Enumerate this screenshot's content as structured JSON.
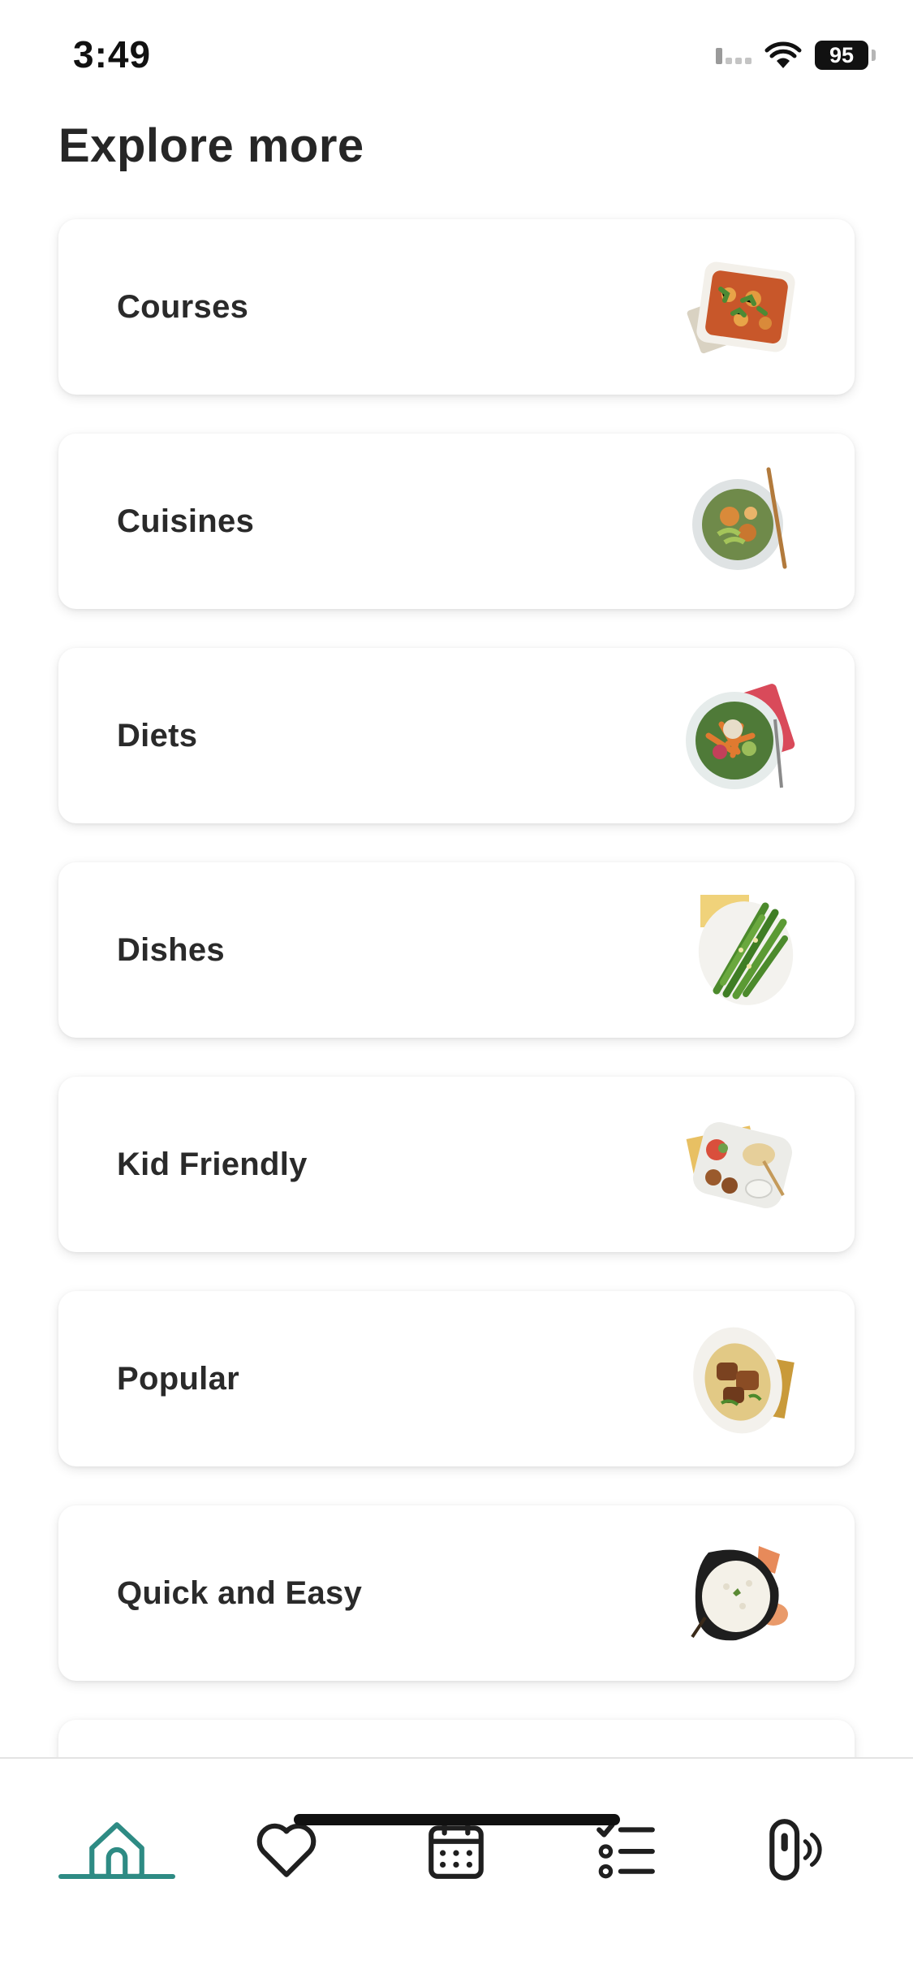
{
  "status_bar": {
    "time": "3:49",
    "battery": "95",
    "icons": [
      "cellular-signal-icon",
      "wifi-icon",
      "battery-icon"
    ]
  },
  "header": {
    "title": "Explore more"
  },
  "categories": [
    {
      "label": "Courses",
      "icon": "casserole-dish-icon"
    },
    {
      "label": "Cuisines",
      "icon": "noodle-bowl-icon"
    },
    {
      "label": "Diets",
      "icon": "salad-bowl-icon"
    },
    {
      "label": "Dishes",
      "icon": "asparagus-plate-icon"
    },
    {
      "label": "Kid Friendly",
      "icon": "kids-tray-icon"
    },
    {
      "label": "Popular",
      "icon": "meat-plate-icon"
    },
    {
      "label": "Quick and Easy",
      "icon": "rice-bowl-icon"
    }
  ],
  "bottom_nav": {
    "active": "home",
    "items": [
      "home-icon",
      "heart-icon",
      "calendar-icon",
      "checklist-icon",
      "device-icon"
    ]
  },
  "colors": {
    "accent": "#2e8b84",
    "text": "#2a2a2a",
    "background": "#ffffff"
  }
}
